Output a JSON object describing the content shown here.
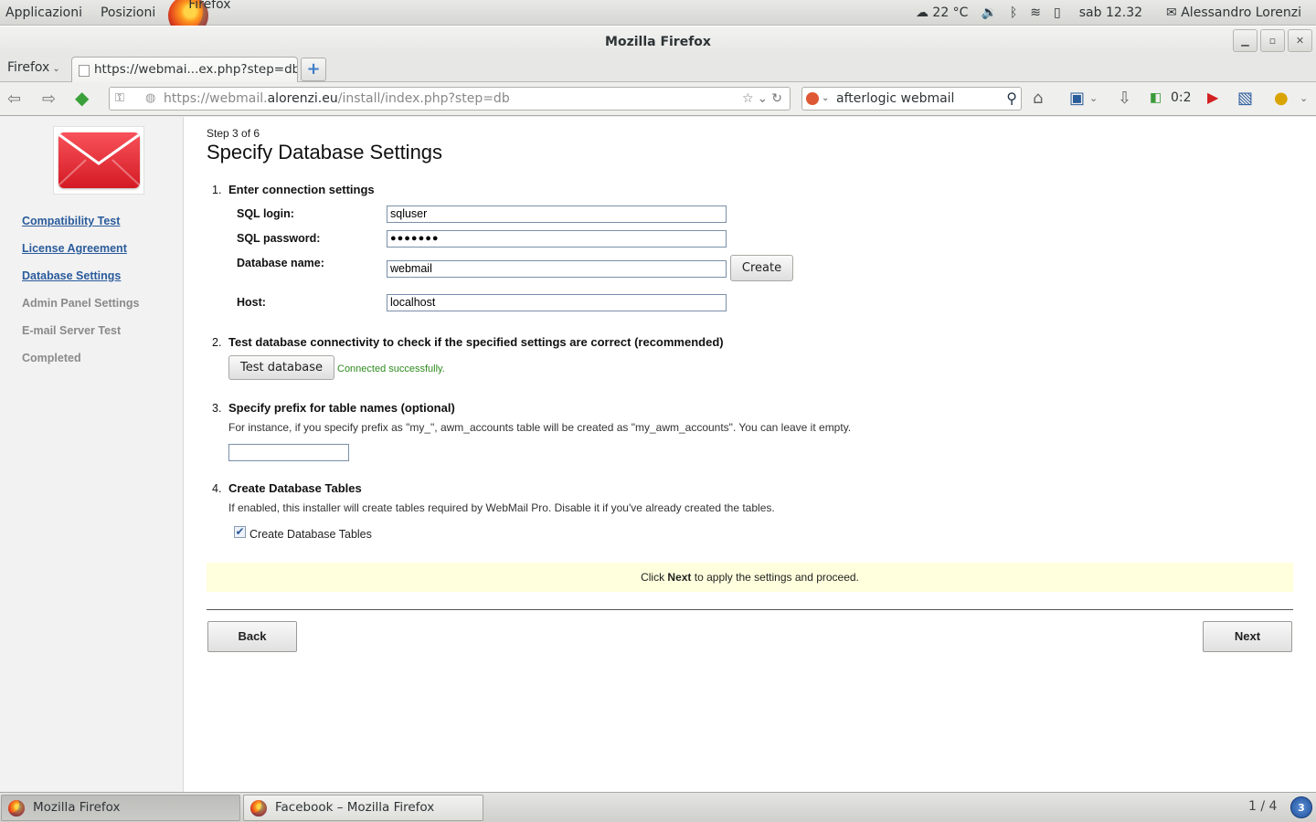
{
  "panel": {
    "applications": "Applicazioni",
    "places": "Posizioni",
    "active_app": "Firefox",
    "weather": "22 °C",
    "clock": "sab 12.32",
    "user": "Alessandro Lorenzi"
  },
  "window": {
    "title": "Mozilla Firefox"
  },
  "tabbar": {
    "menu_label": "Firefox",
    "active_tab": "https://webmai...ex.php?step=db"
  },
  "navbar": {
    "url_prefix": "https://webmail.",
    "url_domain": "alorenzi.eu",
    "url_path": "/install/index.php?step=db",
    "search_value": "afterlogic webmail",
    "counter": "0:2"
  },
  "sidebar": {
    "items": [
      {
        "label": "Compatibility Test",
        "state": "done"
      },
      {
        "label": "License Agreement",
        "state": "done"
      },
      {
        "label": "Database Settings",
        "state": "done"
      },
      {
        "label": "Admin Panel Settings",
        "state": "todo"
      },
      {
        "label": "E-mail Server Test",
        "state": "todo"
      },
      {
        "label": "Completed",
        "state": "todo"
      }
    ]
  },
  "main": {
    "step": "Step 3 of 6",
    "title": "Specify Database Settings",
    "sections": [
      {
        "num": "1.",
        "heading": "Enter connection settings"
      },
      {
        "num": "2.",
        "heading": "Test database connectivity to check if the specified settings are correct (recommended)"
      },
      {
        "num": "3.",
        "heading": "Specify prefix for table names (optional)",
        "desc": "For instance, if you specify prefix as \"my_\", awm_accounts table will be created as \"my_awm_accounts\". You can leave it empty."
      },
      {
        "num": "4.",
        "heading": "Create Database Tables",
        "desc": "If enabled, this installer will create tables required by WebMail Pro. Disable it if you've already created the tables."
      }
    ],
    "fields": {
      "login_label": "SQL login:",
      "login_value": "sqluser",
      "password_label": "SQL password:",
      "password_value": "●●●●●●●",
      "dbname_label": "Database name:",
      "dbname_value": "webmail",
      "host_label": "Host:",
      "host_value": "localhost"
    },
    "create_button": "Create",
    "test_button": "Test database",
    "test_result": "Connected successfully.",
    "prefix_value": "",
    "create_tables_label": "Create Database Tables",
    "create_tables_checked": true,
    "notice_pre": "Click ",
    "notice_bold": "Next",
    "notice_post": " to apply the settings and proceed.",
    "back_button": "Back",
    "next_button": "Next"
  },
  "taskbar": {
    "tasks": [
      "Mozilla Firefox",
      "Facebook – Mozilla Firefox"
    ],
    "workspace": "1 / 4",
    "notifications": "3"
  },
  "colors": {
    "link": "#2a5b9b",
    "success": "#2e8b1e",
    "notice_bg": "#ffffdd",
    "logo_red": "#e02a33"
  }
}
